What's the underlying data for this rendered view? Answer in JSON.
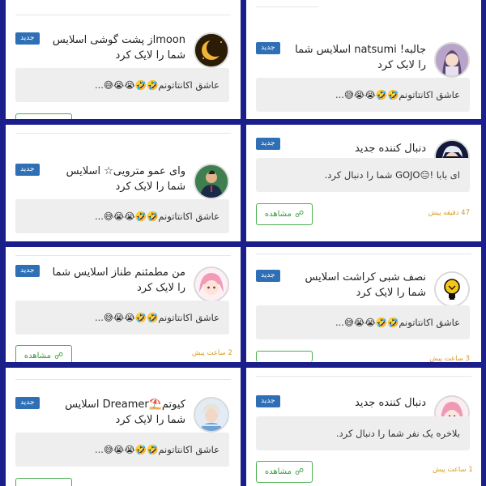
{
  "cards": [
    {
      "id": "c1",
      "title": "moonاز پشت گوشی اسلایس شما را لایک کرد",
      "badge": "جدید",
      "message": "عاشق اکانتاتونم🤣🤣😭😭😅...",
      "avatar": "moon-avatar"
    },
    {
      "id": "c2",
      "title": "جالبه! natsumi اسلایس شما را لایک کرد",
      "badge": "جدید",
      "message": "عاشق اکانتاتونم🤣🤣😭😭😅...",
      "avatar": "anime-girl-avatar"
    },
    {
      "id": "c3",
      "title": "وای عمو مترویی☆ اسلایس شما را لایک کرد",
      "badge": "جدید",
      "message": "عاشق اکانتاتونم🤣🤣😭😭😅...",
      "avatar": "man-suit-avatar"
    },
    {
      "id": "c4",
      "title": "دنبال کننده جدید",
      "badge": "جدید",
      "message": "ای بابا !😑GOJO شما را دنبال کرد.",
      "button": "مشاهده",
      "time": "47 دقیقه پیش",
      "avatar": "gojo-avatar"
    },
    {
      "id": "c5",
      "title": "من مطمئنم طناز اسلایس شما را لایک کرد",
      "badge": "جدید",
      "message": "عاشق اکانتاتونم🤣🤣😭😭😅...",
      "button": "مشاهده",
      "time": "2 ساعت پیش",
      "avatar": "pink-hair-avatar"
    },
    {
      "id": "c6",
      "title": "نصف شبی کراشت اسلایس شما را لایک کرد",
      "badge": "جدید",
      "message": "عاشق اکانتاتونم🤣🤣😭😭😅...",
      "time": "3 ساعت پیش",
      "avatar": "lightbulb-avatar"
    },
    {
      "id": "c7",
      "title": "کیوتم⛱️Dreamer اسلایس شما را لایک کرد",
      "badge": "جدید",
      "message": "عاشق اکانتاتونم🤣🤣😭😭😅...",
      "avatar": "boy-avatar"
    },
    {
      "id": "c8",
      "title": "دنبال کننده جدید",
      "badge": "جدید",
      "message": "بلاخره یک نفر شما را دنبال کرد.",
      "button": "مشاهده",
      "time": "1 ساعت پیش",
      "avatar": "anime-pink-avatar"
    }
  ],
  "colors": {
    "background": "#1a1f8c",
    "badge": "#2f6fb5",
    "button_border": "#4caf50",
    "time": "#d99a1b"
  }
}
